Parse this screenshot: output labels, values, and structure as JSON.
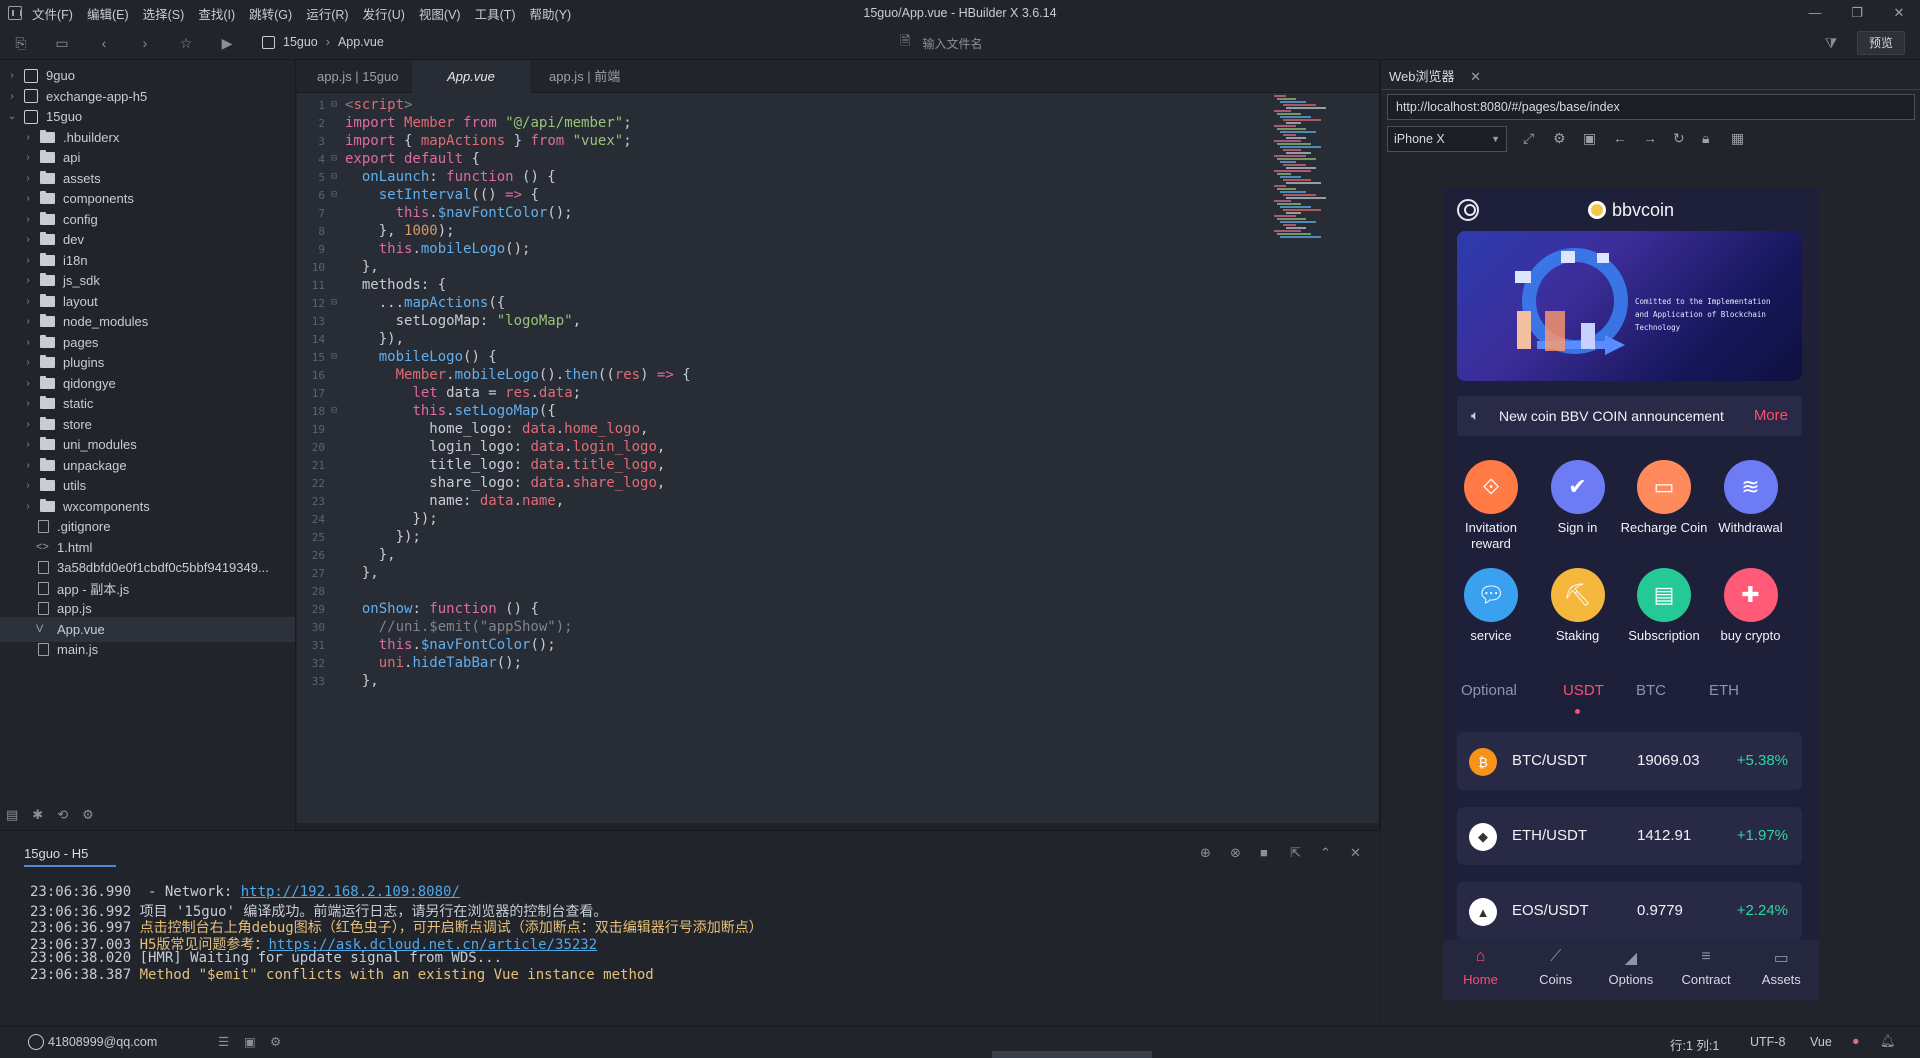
{
  "window": {
    "title": "15guo/App.vue - HBuilder X 3.6.14",
    "menus": [
      "文件(F)",
      "编辑(E)",
      "选择(S)",
      "查找(I)",
      "跳转(G)",
      "运行(R)",
      "发行(U)",
      "视图(V)",
      "工具(T)",
      "帮助(Y)"
    ]
  },
  "toolbar": {
    "breadcrumb": [
      "15guo",
      "App.vue"
    ],
    "file_search_placeholder": "输入文件名",
    "preview_label": "预览"
  },
  "sidebar": {
    "items": [
      {
        "label": "9guo",
        "type": "project",
        "level": 0,
        "expanded": false
      },
      {
        "label": "exchange-app-h5",
        "type": "project",
        "level": 0,
        "expanded": false
      },
      {
        "label": "15guo",
        "type": "project",
        "level": 0,
        "expanded": true
      },
      {
        "label": ".hbuilderx",
        "type": "folder",
        "level": 1
      },
      {
        "label": "api",
        "type": "folder",
        "level": 1
      },
      {
        "label": "assets",
        "type": "folder",
        "level": 1
      },
      {
        "label": "components",
        "type": "folder",
        "level": 1
      },
      {
        "label": "config",
        "type": "folder",
        "level": 1
      },
      {
        "label": "dev",
        "type": "folder",
        "level": 1
      },
      {
        "label": "i18n",
        "type": "folder",
        "level": 1
      },
      {
        "label": "js_sdk",
        "type": "folder",
        "level": 1
      },
      {
        "label": "layout",
        "type": "folder",
        "level": 1
      },
      {
        "label": "node_modules",
        "type": "folder",
        "level": 1
      },
      {
        "label": "pages",
        "type": "folder",
        "level": 1
      },
      {
        "label": "plugins",
        "type": "folder",
        "level": 1
      },
      {
        "label": "qidongye",
        "type": "folder",
        "level": 1
      },
      {
        "label": "static",
        "type": "folder",
        "level": 1
      },
      {
        "label": "store",
        "type": "folder",
        "level": 1
      },
      {
        "label": "uni_modules",
        "type": "folder",
        "level": 1
      },
      {
        "label": "unpackage",
        "type": "folder",
        "level": 1
      },
      {
        "label": "utils",
        "type": "folder",
        "level": 1
      },
      {
        "label": "wxcomponents",
        "type": "folder",
        "level": 1
      },
      {
        "label": ".gitignore",
        "type": "file",
        "level": 1
      },
      {
        "label": "1.html",
        "type": "code",
        "level": 1
      },
      {
        "label": "3a58dbfd0e0f1cbdf0c5bbf9419349...",
        "type": "file",
        "level": 1
      },
      {
        "label": "app - 副本.js",
        "type": "file",
        "level": 1
      },
      {
        "label": "app.js",
        "type": "file",
        "level": 1
      },
      {
        "label": "App.vue",
        "type": "vue",
        "level": 1,
        "active": true
      },
      {
        "label": "main.js",
        "type": "file",
        "level": 1
      }
    ]
  },
  "editor": {
    "tabs": [
      {
        "label": "app.js | 15guo",
        "active": false
      },
      {
        "label": "App.vue",
        "active": true
      },
      {
        "label": "app.js | 前端uniapp",
        "active": false
      }
    ],
    "lines": [
      {
        "n": "1",
        "fold": "⊟",
        "html": "<span class='c'>&lt;</span><span class='v'>script</span><span class='c'>&gt;</span>"
      },
      {
        "n": "2",
        "fold": "",
        "html": "<span class='k'>import</span> <span class='v'>Member</span> <span class='k'>from</span> <span class='s'>\"@/api/member\"</span>;"
      },
      {
        "n": "3",
        "fold": "",
        "html": "<span class='k'>import</span> { <span class='v'>mapActions</span> } <span class='k'>from</span> <span class='s'>\"vuex\"</span>;"
      },
      {
        "n": "4",
        "fold": "⊟",
        "html": "<span class='k'>export default</span> {"
      },
      {
        "n": "5",
        "fold": "⊟",
        "html": "  <span class='f'>onLaunch</span>: <span class='k'>function</span> () {"
      },
      {
        "n": "6",
        "fold": "⊟",
        "html": "    <span class='f'>setInterval</span>(() <span class='k'>=&gt;</span> {"
      },
      {
        "n": "7",
        "fold": "",
        "html": "      <span class='k'>this</span>.<span class='f'>$navFontColor</span>();"
      },
      {
        "n": "8",
        "fold": "",
        "html": "    }, <span class='n'>1000</span>);"
      },
      {
        "n": "9",
        "fold": "",
        "html": "    <span class='k'>this</span>.<span class='f'>mobileLogo</span>();"
      },
      {
        "n": "10",
        "fold": "",
        "html": "  },"
      },
      {
        "n": "11",
        "fold": "",
        "html": "  methods: {"
      },
      {
        "n": "12",
        "fold": "⊟",
        "html": "    ...<span class='f'>mapActions</span>({"
      },
      {
        "n": "13",
        "fold": "",
        "html": "      setLogoMap: <span class='s'>\"logoMap\"</span>,"
      },
      {
        "n": "14",
        "fold": "",
        "html": "    }),"
      },
      {
        "n": "15",
        "fold": "⊟",
        "html": "    <span class='f'>mobileLogo</span>() {"
      },
      {
        "n": "16",
        "fold": "",
        "html": "      <span class='v'>Member</span>.<span class='f'>mobileLogo</span>().<span class='f'>then</span>((<span class='v'>res</span>) <span class='k'>=&gt;</span> {"
      },
      {
        "n": "17",
        "fold": "",
        "html": "        <span class='k'>let</span> data = <span class='v'>res</span>.<span class='v'>data</span>;"
      },
      {
        "n": "18",
        "fold": "⊟",
        "html": "        <span class='k'>this</span>.<span class='f'>setLogoMap</span>({"
      },
      {
        "n": "19",
        "fold": "",
        "html": "          home_logo: <span class='v'>data</span>.<span class='v'>home_logo</span>,"
      },
      {
        "n": "20",
        "fold": "",
        "html": "          login_logo: <span class='v'>data</span>.<span class='v'>login_logo</span>,"
      },
      {
        "n": "21",
        "fold": "",
        "html": "          title_logo: <span class='v'>data</span>.<span class='v'>title_logo</span>,"
      },
      {
        "n": "22",
        "fold": "",
        "html": "          share_logo: <span class='v'>data</span>.<span class='v'>share_logo</span>,"
      },
      {
        "n": "23",
        "fold": "",
        "html": "          name: <span class='v'>data</span>.<span class='v'>name</span>,"
      },
      {
        "n": "24",
        "fold": "",
        "html": "        });"
      },
      {
        "n": "25",
        "fold": "",
        "html": "      });"
      },
      {
        "n": "26",
        "fold": "",
        "html": "    },"
      },
      {
        "n": "27",
        "fold": "",
        "html": "  },"
      },
      {
        "n": "28",
        "fold": "",
        "html": ""
      },
      {
        "n": "29",
        "fold": "",
        "html": "  <span class='f'>onShow</span>: <span class='k'>function</span> () {"
      },
      {
        "n": "30",
        "fold": "",
        "html": "    <span class='c'>//uni.$emit(\"appShow\");</span>"
      },
      {
        "n": "31",
        "fold": "",
        "html": "    <span class='k'>this</span>.<span class='f'>$navFontColor</span>();"
      },
      {
        "n": "32",
        "fold": "",
        "html": "    <span class='v'>uni</span>.<span class='f'>hideTabBar</span>();"
      },
      {
        "n": "33",
        "fold": "",
        "html": "  },"
      }
    ]
  },
  "console": {
    "tab_label": "15guo - H5",
    "logs": [
      {
        "html": "23:06:36.990  - Network: <a>http://192.168.2.109:8080/</a>"
      },
      {
        "html": "23:06:36.992 项目 '15guo' 编译成功。前端运行日志，请另行在浏览器的控制台查看。"
      },
      {
        "html": "23:06:36.997 <span class='y'>点击控制台右上角debug图标（红色虫子），可开启断点调试（添加断点：双击编辑器行号添加断点）</span>"
      },
      {
        "html": "23:06:37.003 <span class='y'>H5版常见问题参考：</span><a>https://ask.dcloud.net.cn/article/35232</a>"
      },
      {
        "html": "23:06:38.020 [HMR] Waiting for update signal from WDS..."
      },
      {
        "html": "23:06:38.387 <span class='y'>Method \"$emit\" conflicts with an existing Vue instance method</span>"
      }
    ]
  },
  "status": {
    "user": "41808999@qq.com",
    "position": "行:1  列:1",
    "encoding": "UTF-8",
    "language": "Vue"
  },
  "browser": {
    "tab_label": "Web浏览器",
    "url": "http://localhost:8080/#/pages/base/index",
    "device": "iPhone X",
    "app": {
      "brand": "bbvcoin",
      "banner_text": "Comitted to the Implementation and Application of Blockchain Technology",
      "notice": "New coin BBV COIN announcement",
      "notice_more": "More",
      "features": [
        {
          "label": "Invitation reward",
          "icon": "share-icon",
          "color": "#ff7a45"
        },
        {
          "label": "Sign in",
          "icon": "calendar-check-icon",
          "color": "#6d7cf5"
        },
        {
          "label": "Recharge Coin",
          "icon": "wallet-icon",
          "color": "#ff8a5c"
        },
        {
          "label": "Withdrawal",
          "icon": "coins-stack-icon",
          "color": "#6d7cf5"
        },
        {
          "label": "service",
          "icon": "chat-bubble-icon",
          "color": "#3aa0f0"
        },
        {
          "label": "Staking",
          "icon": "pickaxe-icon",
          "color": "#f5b83d"
        },
        {
          "label": "Subscription",
          "icon": "card-icon",
          "color": "#24c996"
        },
        {
          "label": "buy crypto",
          "icon": "bag-icon",
          "color": "#ff5a78"
        }
      ],
      "market_tabs": [
        {
          "label": "Optional",
          "active": false
        },
        {
          "label": "USDT",
          "active": true
        },
        {
          "label": "BTC",
          "active": false
        },
        {
          "label": "ETH",
          "active": false
        }
      ],
      "markets": [
        {
          "pair": "BTC/USDT",
          "price": "19069.03",
          "change": "+5.38%",
          "color": "#f7931a",
          "sym": "₿"
        },
        {
          "pair": "ETH/USDT",
          "price": "1412.91",
          "change": "+1.97%",
          "color": "#ffffff",
          "sym": "◆"
        },
        {
          "pair": "EOS/USDT",
          "price": "0.9779",
          "change": "+2.24%",
          "color": "#ffffff",
          "sym": "▲"
        }
      ],
      "nav": [
        {
          "label": "Home",
          "icon": "home-icon",
          "active": true
        },
        {
          "label": "Coins",
          "icon": "coins-icon",
          "active": false
        },
        {
          "label": "Options",
          "icon": "options-icon",
          "active": false
        },
        {
          "label": "Contract",
          "icon": "contract-icon",
          "active": false
        },
        {
          "label": "Assets",
          "icon": "assets-icon",
          "active": false
        }
      ]
    }
  }
}
